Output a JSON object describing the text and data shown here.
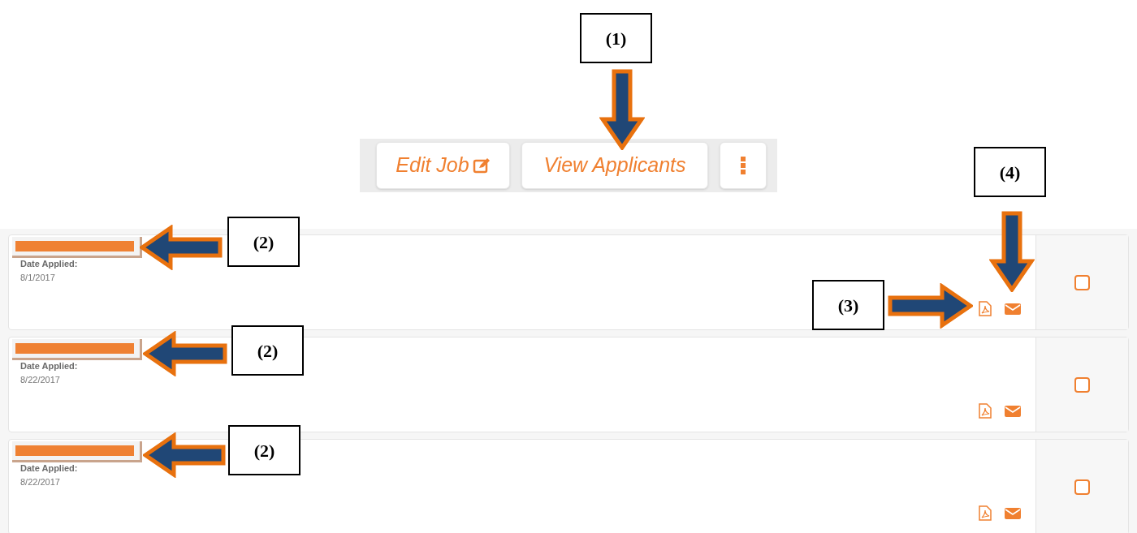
{
  "toolbar": {
    "buttons": [
      {
        "kind": "edit",
        "label": "Edit Job"
      },
      {
        "kind": "view",
        "label": "View Applicants"
      },
      {
        "kind": "more"
      }
    ]
  },
  "applicants": [
    {
      "date_label": "Date Applied:",
      "date": "8/1/2017",
      "checked": false
    },
    {
      "date_label": "Date Applied:",
      "date": "8/22/2017",
      "checked": false
    },
    {
      "date_label": "Date Applied:",
      "date": "8/22/2017",
      "checked": false
    }
  ],
  "callouts": [
    {
      "label": "(1)",
      "kind": "down"
    },
    {
      "label": "(2)",
      "kind": "left"
    },
    {
      "label": "(2)",
      "kind": "left"
    },
    {
      "label": "(2)",
      "kind": "left"
    },
    {
      "label": "(3)",
      "kind": "right"
    },
    {
      "label": "(4)",
      "kind": "down"
    }
  ]
}
